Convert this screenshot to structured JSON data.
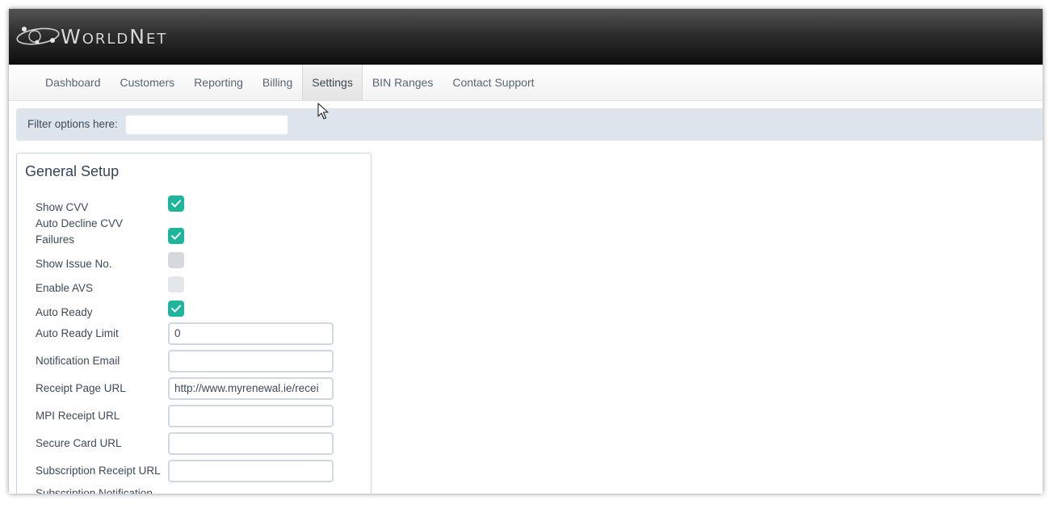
{
  "brand": {
    "name": "WorldNet",
    "logo_icon": "orbit-logo-icon"
  },
  "nav": {
    "items": [
      {
        "label": "Dashboard",
        "active": false
      },
      {
        "label": "Customers",
        "active": false
      },
      {
        "label": "Reporting",
        "active": false
      },
      {
        "label": "Billing",
        "active": false
      },
      {
        "label": "Settings",
        "active": true
      },
      {
        "label": "BIN Ranges",
        "active": false
      },
      {
        "label": "Contact Support",
        "active": false
      }
    ]
  },
  "filter": {
    "label": "Filter options here:",
    "value": ""
  },
  "general_setup": {
    "title": "General Setup",
    "show_cvv": {
      "label": "Show CVV",
      "checked": true
    },
    "auto_decline_cvv": {
      "label_line1": "Auto Decline CVV",
      "label_line2": "Failures",
      "checked": true
    },
    "show_issue_no": {
      "label": "Show Issue No.",
      "checked": false
    },
    "enable_avs": {
      "label": "Enable AVS",
      "checked": false,
      "disabled": true
    },
    "auto_ready": {
      "label": "Auto Ready",
      "checked": true
    },
    "auto_ready_limit": {
      "label": "Auto Ready Limit",
      "value": "0"
    },
    "notification_email": {
      "label": "Notification Email",
      "value": ""
    },
    "receipt_page_url": {
      "label": "Receipt Page URL",
      "value": "http://www.myrenewal.ie/recei"
    },
    "mpi_receipt_url": {
      "label": "MPI Receipt URL",
      "value": ""
    },
    "secure_card_url": {
      "label": "Secure Card URL",
      "value": ""
    },
    "subscription_receipt_url": {
      "label": "Subscription Receipt URL",
      "value": ""
    },
    "subscription_notification": {
      "label": "Subscription Notification"
    }
  },
  "colors": {
    "accent": "#1fb59c",
    "header_dark": "#0d0d0d",
    "filter_bg": "#dde4ec"
  }
}
